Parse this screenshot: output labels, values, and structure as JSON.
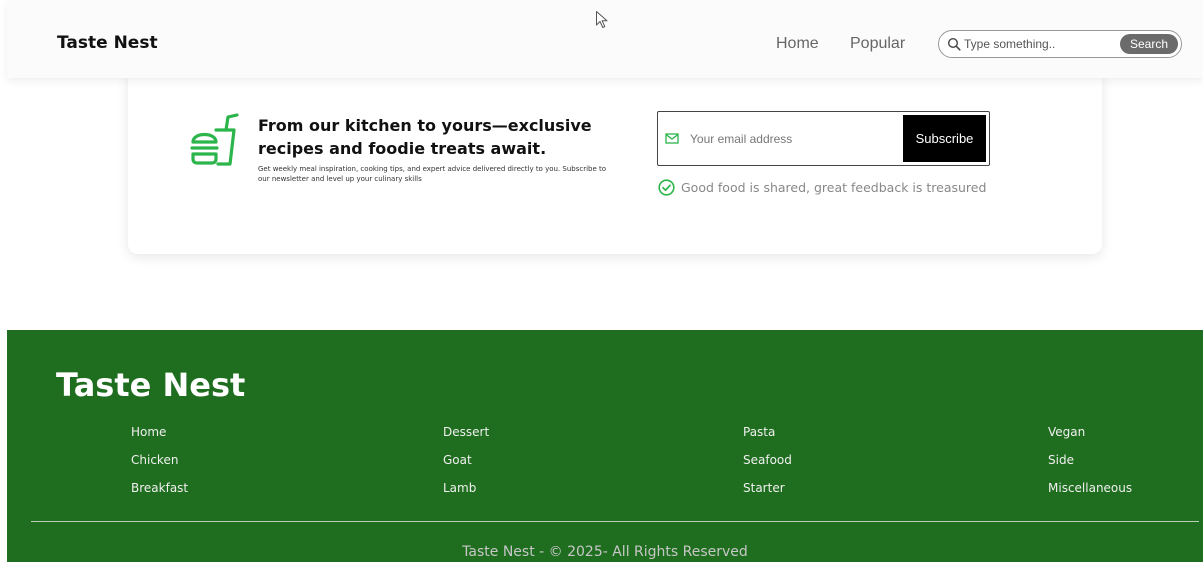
{
  "navbar": {
    "brand": "Taste Nest",
    "links": [
      "Home",
      "Popular"
    ],
    "search": {
      "placeholder": "Type something..",
      "button_label": "Search"
    }
  },
  "newsletter": {
    "headline": "From our kitchen to yours—exclusive recipes and foodie treats await.",
    "subtext": "Get weekly meal inspiration, cooking tips, and expert advice delivered directly to you. Subscribe to our newsletter and level up your culinary skills",
    "email_placeholder": "Your email address",
    "subscribe_label": "Subscribe",
    "feedback": "Good food is shared, great feedback is treasured"
  },
  "footer": {
    "brand": "Taste Nest",
    "columns": [
      [
        "Home",
        "Chicken",
        "Breakfast"
      ],
      [
        "Dessert",
        "Goat",
        "Lamb"
      ],
      [
        "Pasta",
        "Seafood",
        "Starter"
      ],
      [
        "Vegan",
        "Side",
        "Miscellaneous"
      ]
    ],
    "copyright": "Taste Nest - © 2025- All Rights Reserved"
  },
  "icons": {
    "search": "search-icon",
    "food": "burger-drink-icon",
    "mail": "mail-icon",
    "check": "check-circle-icon",
    "cursor": "mouse-cursor-icon"
  },
  "colors": {
    "footer_bg": "#1f6d1f",
    "accent_green": "#2bb54a",
    "subscribe_bg": "#000000",
    "search_button_bg": "#6b6b6b"
  }
}
